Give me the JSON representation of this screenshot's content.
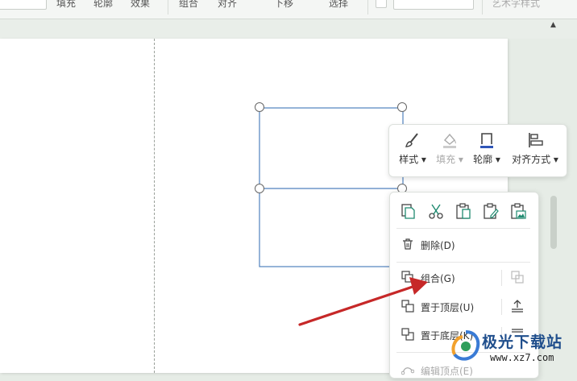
{
  "ribbon": {
    "fill": "填充",
    "outline": "轮廓",
    "effects": "效果",
    "group": "组合",
    "align": "对齐",
    "move_down": "下移",
    "select": "选择",
    "text_style": "艺术字样式"
  },
  "float_toolbar": {
    "style": "样式",
    "fill": "填充",
    "outline": "轮廓",
    "align": "对齐方式"
  },
  "context_menu": {
    "delete": "删除(D)",
    "group": "组合(G)",
    "bring_to_front": "置于顶层(U)",
    "send_to_back": "置于底层(K)",
    "edit_points": "编辑顶点(E)"
  },
  "watermark": {
    "title": "极光下载站",
    "url": "www.xz7.com"
  },
  "colors": {
    "shape_stroke": "#4f81bd",
    "arrow": "#c62828",
    "outline_icon_bar": "#2f55b8",
    "watermark_blue": "#1f4e8c"
  }
}
